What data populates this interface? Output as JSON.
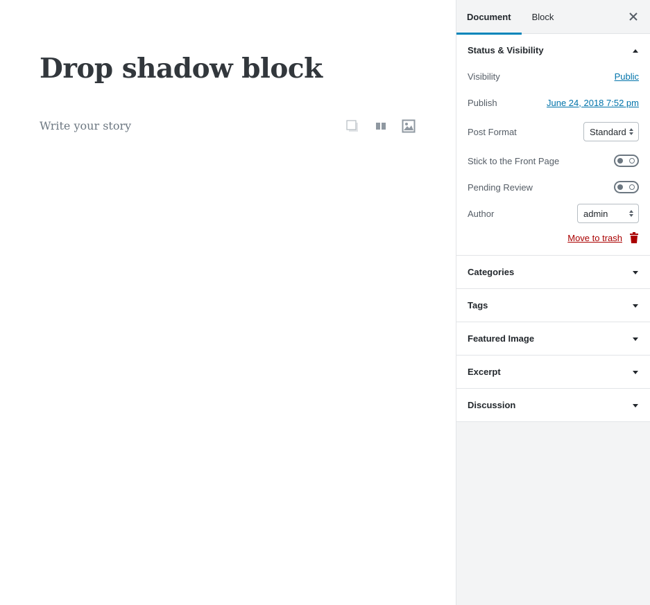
{
  "editor": {
    "title": "Drop shadow block",
    "placeholder": "Write your story"
  },
  "sidebar": {
    "tabs": [
      {
        "label": "Document",
        "active": true
      },
      {
        "label": "Block",
        "active": false
      }
    ],
    "status": {
      "heading": "Status & Visibility",
      "visibility_label": "Visibility",
      "visibility_value": "Public",
      "publish_label": "Publish",
      "publish_value": "June 24, 2018 7:52 pm",
      "post_format_label": "Post Format",
      "post_format_value": "Standard",
      "stick_label": "Stick to the Front Page",
      "pending_label": "Pending Review",
      "author_label": "Author",
      "author_value": "admin",
      "trash_label": "Move to trash"
    },
    "sections": [
      {
        "label": "Categories"
      },
      {
        "label": "Tags"
      },
      {
        "label": "Featured Image"
      },
      {
        "label": "Excerpt"
      },
      {
        "label": "Discussion"
      }
    ]
  },
  "colors": {
    "accent": "#0085ba",
    "link": "#0073aa",
    "danger": "#a00"
  }
}
